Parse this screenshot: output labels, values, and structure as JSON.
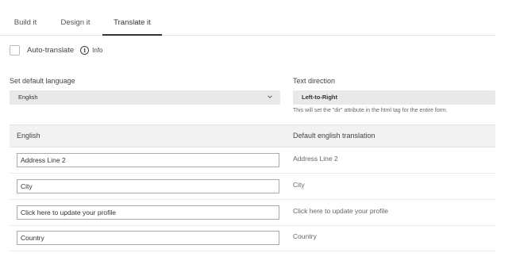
{
  "tabs": [
    {
      "label": "Build it",
      "active": false
    },
    {
      "label": "Design it",
      "active": false
    },
    {
      "label": "Translate it",
      "active": true
    }
  ],
  "auto_translate": {
    "label": "Auto-translate",
    "checked": false,
    "info_label": "Info"
  },
  "language": {
    "label": "Set default language",
    "selected": "English"
  },
  "direction": {
    "label": "Text direction",
    "value": "Left-to-Right",
    "hint": "This will set the \"dir\" attribute in the html tag for the entire form."
  },
  "table": {
    "headers": [
      "English",
      "Default english translation"
    ],
    "rows": [
      {
        "value": "Address Line 2",
        "default": "Address Line 2"
      },
      {
        "value": "City",
        "default": "City"
      },
      {
        "value": "Click here to update your profile",
        "default": "Click here to update your profile"
      },
      {
        "value": "Country",
        "default": "Country"
      }
    ]
  }
}
